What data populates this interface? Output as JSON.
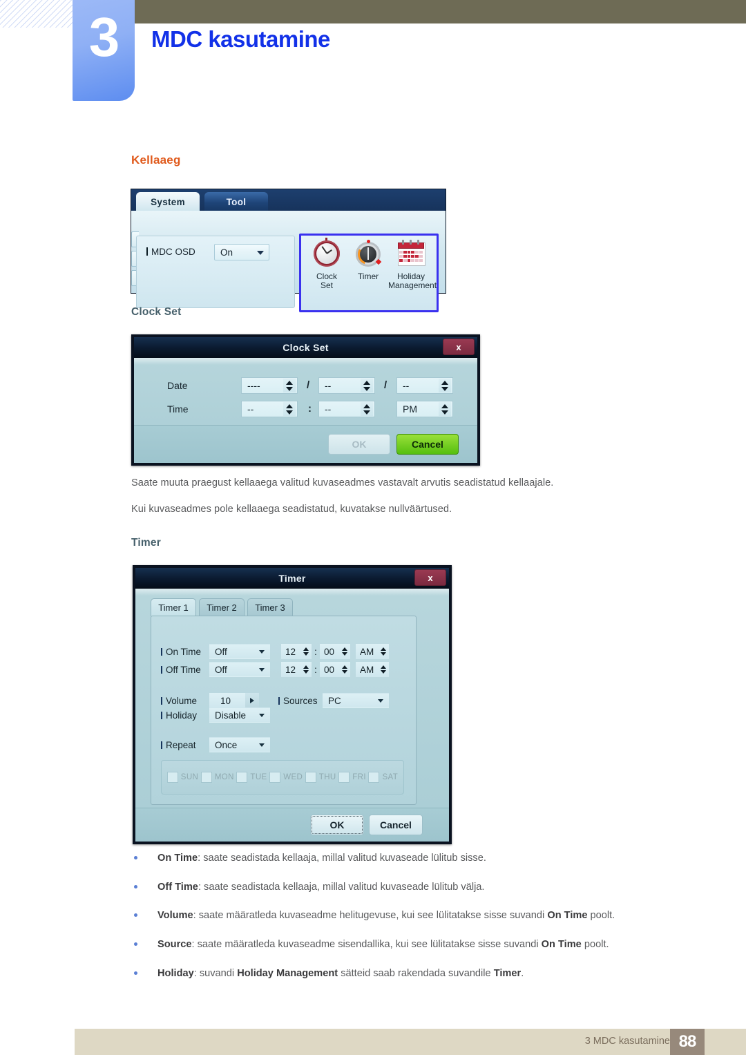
{
  "header": {
    "chapter_number": "3",
    "chapter_title": "MDC kasutamine"
  },
  "sections": {
    "kellaaeg_heading": "Kellaaeg",
    "clock_set_heading": "Clock Set",
    "timer_heading": "Timer"
  },
  "paragraphs": {
    "p1": "Saate muuta praegust kellaaega valitud kuvaseadmes vastavalt arvutis seadistatud kellaajale.",
    "p2": "Kui kuvaseadmes pole kellaaega seadistatud, kuvatakse nullväärtused."
  },
  "system_panel": {
    "tabs": [
      {
        "label": "System",
        "active": true
      },
      {
        "label": "Tool",
        "active": false
      }
    ],
    "mdc_osd_label": "MDC OSD",
    "mdc_osd_value": "On",
    "icons": [
      {
        "name": "clock-set-icon",
        "caption": "Clock\nSet"
      },
      {
        "name": "timer-icon",
        "caption": "Timer"
      },
      {
        "name": "holiday-management-icon",
        "caption": "Holiday\nManagement"
      }
    ],
    "highlight_color": "#3a31ef"
  },
  "clock_set_dialog": {
    "title": "Clock Set",
    "close_label": "x",
    "date_label": "Date",
    "time_label": "Time",
    "date_year": "----",
    "date_month": "--",
    "date_day": "--",
    "date_sep1": "/",
    "date_sep2": "/",
    "time_hour": "--",
    "time_minute": "--",
    "time_meridiem": "PM",
    "time_sep": ":",
    "ok_label": "OK",
    "cancel_label": "Cancel",
    "cancel_color": "#6ecb1a"
  },
  "timer_dialog": {
    "title": "Timer",
    "close_label": "x",
    "tabs": [
      {
        "label": "Timer 1",
        "active": true
      },
      {
        "label": "Timer 2",
        "active": false
      },
      {
        "label": "Timer 3",
        "active": false
      }
    ],
    "on_time": {
      "label": "On Time",
      "mode": "Off",
      "hour": "12",
      "minute": "00",
      "meridiem": "AM",
      "separator": ":"
    },
    "off_time": {
      "label": "Off Time",
      "mode": "Off",
      "hour": "12",
      "minute": "00",
      "meridiem": "AM",
      "separator": ":"
    },
    "volume": {
      "label": "Volume",
      "value": "10"
    },
    "sources": {
      "label": "Sources",
      "value": "PC"
    },
    "holiday": {
      "label": "Holiday",
      "value": "Disable"
    },
    "repeat": {
      "label": "Repeat",
      "value": "Once"
    },
    "days": [
      "SUN",
      "MON",
      "TUE",
      "WED",
      "THU",
      "FRI",
      "SAT"
    ],
    "ok_label": "OK",
    "cancel_label": "Cancel"
  },
  "bullets": [
    {
      "term": "On Time",
      "rest": ": saate seadistada kellaaja, millal valitud kuvaseade lülitub sisse."
    },
    {
      "term": "Off Time",
      "rest": ": saate seadistada kellaaja, millal valitud kuvaseade lülitub välja."
    },
    {
      "term": "Volume",
      "rest": ": saate määratleda kuvaseadme helitugevuse, kui see lülitatakse sisse suvandi ",
      "term2": "On Time",
      "rest2": " poolt."
    },
    {
      "term": "Source",
      "rest": ": saate määratleda kuvaseadme sisendallika, kui see lülitatakse sisse suvandi ",
      "term2": "On Time",
      "rest2": " poolt."
    },
    {
      "term": "Holiday",
      "rest": ": suvandi ",
      "term2": "Holiday Management",
      "rest2": " sätteid saab rakendada suvandile ",
      "term3": "Timer",
      "rest3": "."
    }
  ],
  "footer": {
    "text": "3 MDC kasutamine",
    "page": "88"
  }
}
